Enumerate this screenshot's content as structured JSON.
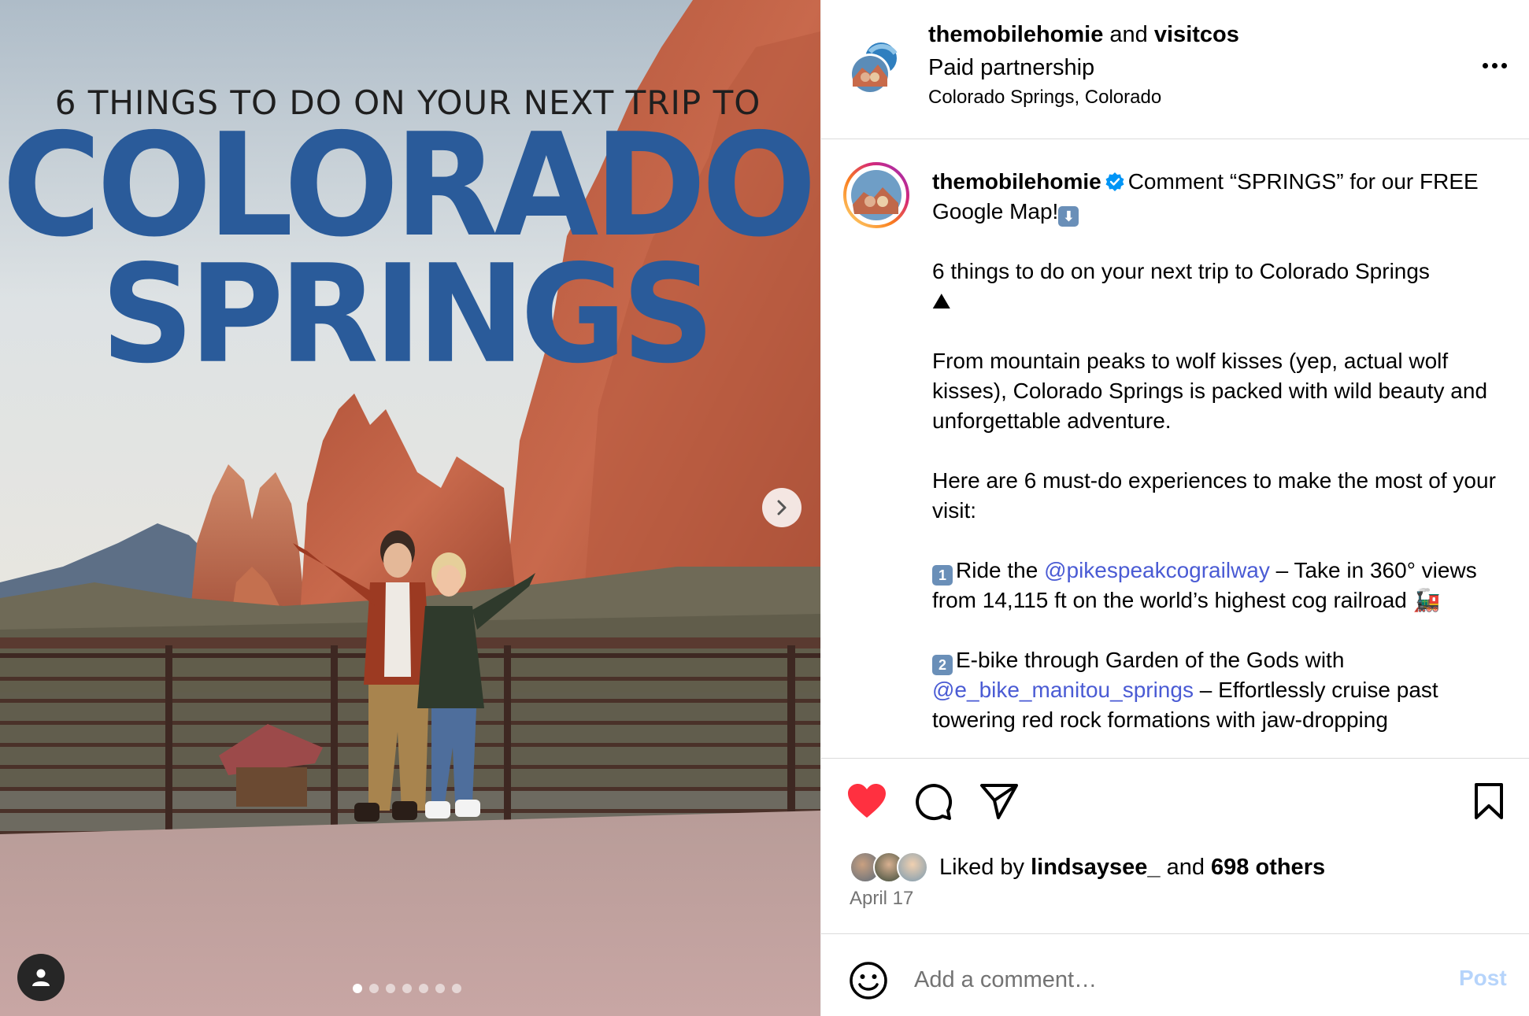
{
  "photo": {
    "headline_small": "6 THINGS TO DO ON YOUR NEXT TRIP TO",
    "headline_line1": "COLORADO",
    "headline_line2": "SPRINGS",
    "carousel": {
      "slide_count": 7,
      "active_index": 0
    },
    "next_icon": "chevron-right-icon",
    "tag_icon": "person-icon"
  },
  "header": {
    "author": "themobilehomie",
    "conjunction": "and",
    "collaborator": "visitcos",
    "partnership": "Paid partnership",
    "location": "Colorado Springs, Colorado"
  },
  "caption": {
    "username": "themobilehomie",
    "intro": "Comment “SPRINGS” for our FREE Google Map!",
    "intro_emoji": "⬇",
    "title": "6 things to do on your next trip to Colorado Springs",
    "title_emoji": "⛰",
    "para1": "From mountain peaks to wolf kisses (yep, actual wolf kisses), Colorado Springs is packed with wild beauty and unforgettable adventure.",
    "para2": "Here are 6 must-do experiences to make the most of your visit:",
    "item1_num": "1",
    "item1_prefix": "Ride the ",
    "item1_mention": "@pikespeakcograilway",
    "item1_suffix": " – Take in 360° views from 14,115 ft on the world’s highest cog railroad ",
    "item1_emoji": "🚂",
    "item2_num": "2",
    "item2_prefix": "E-bike through Garden of the Gods with ",
    "item2_mention": "@e_bike_manitou_springs",
    "item2_suffix": " – Effortlessly cruise past towering red rock formations with jaw-dropping"
  },
  "likes": {
    "prefix": "Liked by ",
    "user": "lindsaysee_",
    "middle": " and ",
    "others": "698 others"
  },
  "date": "April 17",
  "comment": {
    "placeholder": "Add a comment…",
    "post_label": "Post"
  },
  "colors": {
    "headline_blue": "#2a5b9a",
    "like_red": "#ff3040",
    "mention_blue": "#4a5bd4",
    "post_disabled": "#b6d4fb",
    "verified_blue": "#0095f6"
  }
}
